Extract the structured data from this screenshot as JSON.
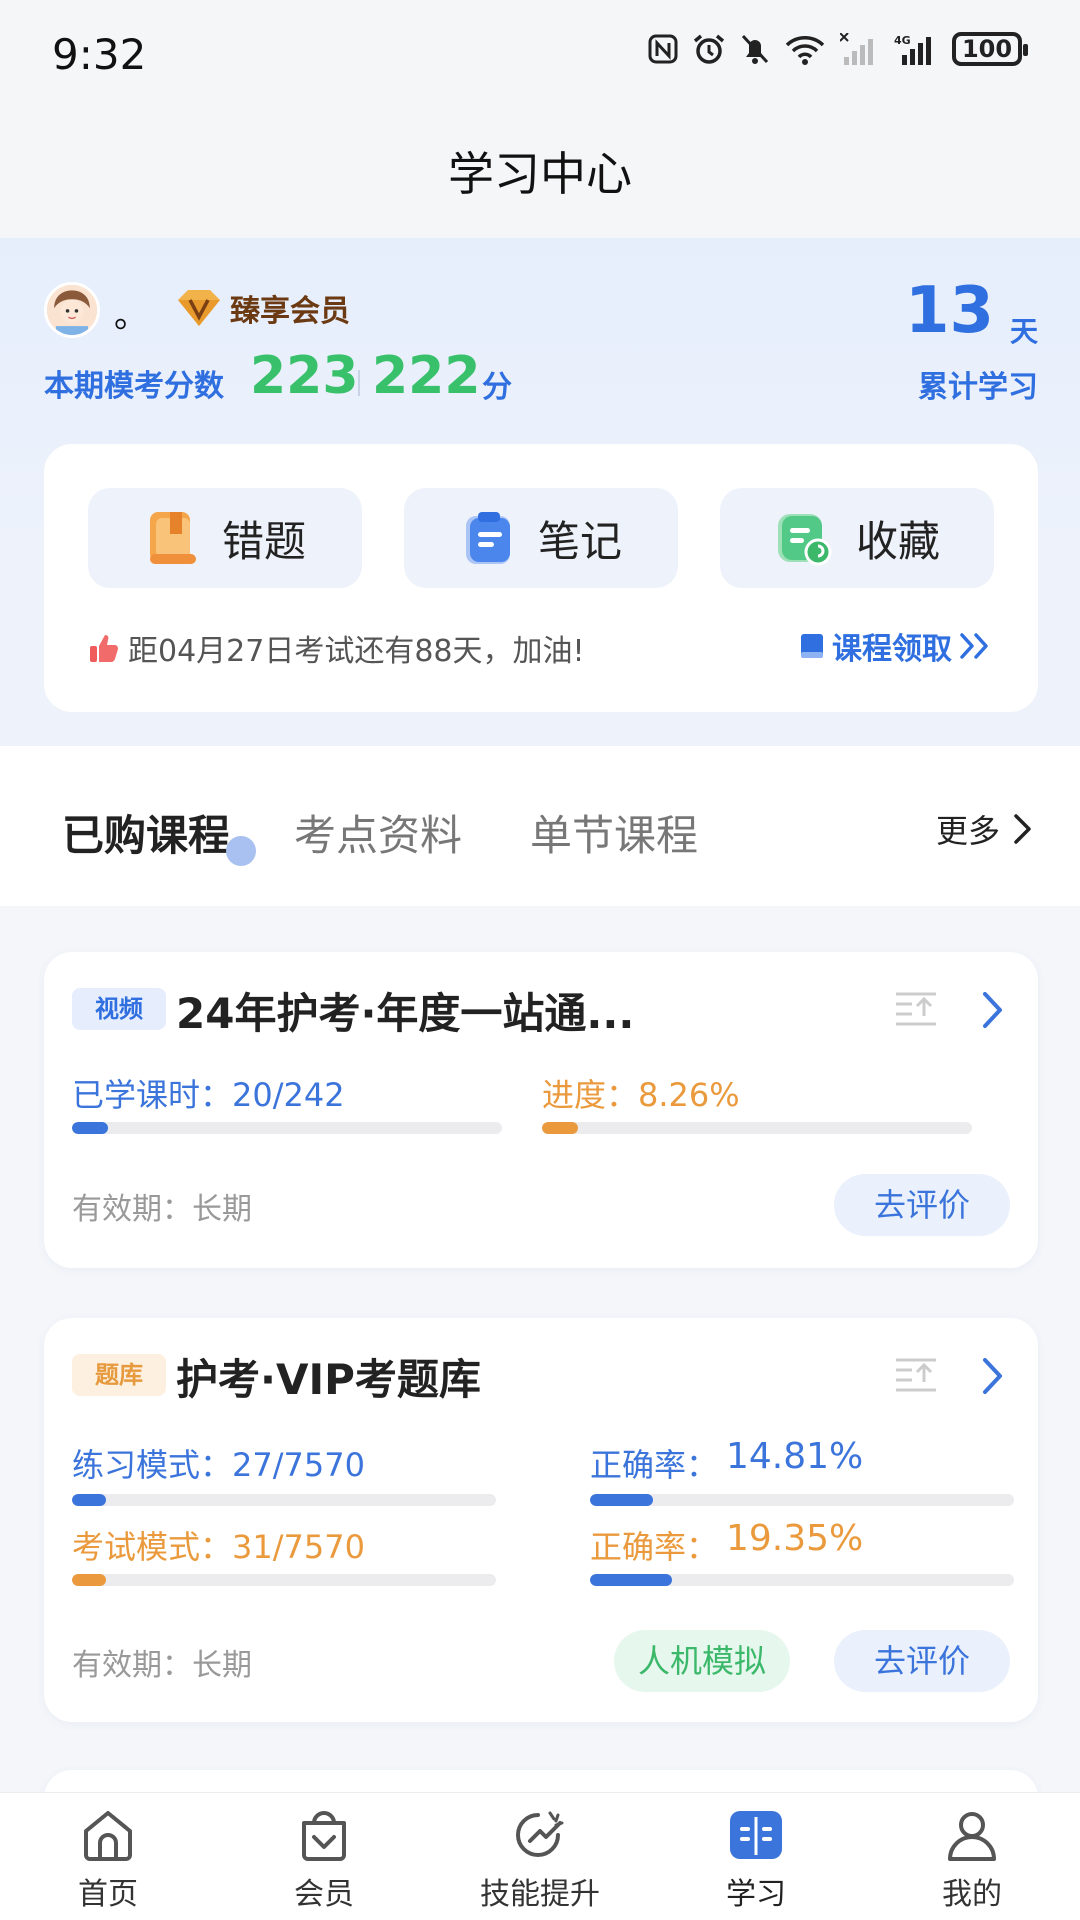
{
  "status_bar": {
    "time": "9:32",
    "battery": "100"
  },
  "header": {
    "title": "学习中心"
  },
  "user": {
    "name": "。",
    "vip_label": "臻享会员",
    "score_label": "本期模考分数",
    "score_1": "223",
    "score_2": "222",
    "score_unit": "分",
    "days_value": "13",
    "days_unit": "天",
    "days_label": "累计学习"
  },
  "quick_actions": [
    {
      "label": "错题",
      "icon": "wrong-questions-icon"
    },
    {
      "label": "笔记",
      "icon": "notes-icon"
    },
    {
      "label": "收藏",
      "icon": "favorites-icon"
    }
  ],
  "countdown": "距04月27日考试还有88天，加油!",
  "course_claim": "课程领取",
  "tabs": [
    {
      "label": "已购课程",
      "active": true
    },
    {
      "label": "考点资料",
      "active": false
    },
    {
      "label": "单节课程",
      "active": false
    }
  ],
  "more_label": "更多",
  "courses": [
    {
      "tag": "视频",
      "title": "24年护考·年度一站通...",
      "studied_label": "已学课时：20/242",
      "studied_fraction": 0.0826,
      "progress_label": "进度：8.26%",
      "progress_fraction": 0.0826,
      "validity": "有效期：长期",
      "review_button": "去评价"
    },
    {
      "tag": "题库",
      "title": "护考·VIP考题库",
      "practice_label": "练习模式：27/7570",
      "practice_fraction": 0.0036,
      "practice_accuracy_label": "正确率：",
      "practice_accuracy": "14.81%",
      "practice_accuracy_fraction": 0.1481,
      "exam_label": "考试模式：31/7570",
      "exam_fraction": 0.0041,
      "exam_accuracy_label": "正确率：",
      "exam_accuracy": "19.35%",
      "exam_accuracy_fraction": 0.1935,
      "validity": "有效期：长期",
      "sim_button": "人机模拟",
      "review_button": "去评价"
    }
  ],
  "bottom_nav": [
    {
      "label": "首页",
      "icon": "home-icon",
      "active": false
    },
    {
      "label": "会员",
      "icon": "membership-icon",
      "active": false
    },
    {
      "label": "技能提升",
      "icon": "skill-icon",
      "active": false
    },
    {
      "label": "学习",
      "icon": "study-icon",
      "active": true
    },
    {
      "label": "我的",
      "icon": "profile-icon",
      "active": false
    }
  ],
  "colors": {
    "accent_blue": "#2f6fe0",
    "score_green": "#39c06a",
    "orange": "#ea9a3c",
    "vip_brown": "#6b3a12"
  }
}
